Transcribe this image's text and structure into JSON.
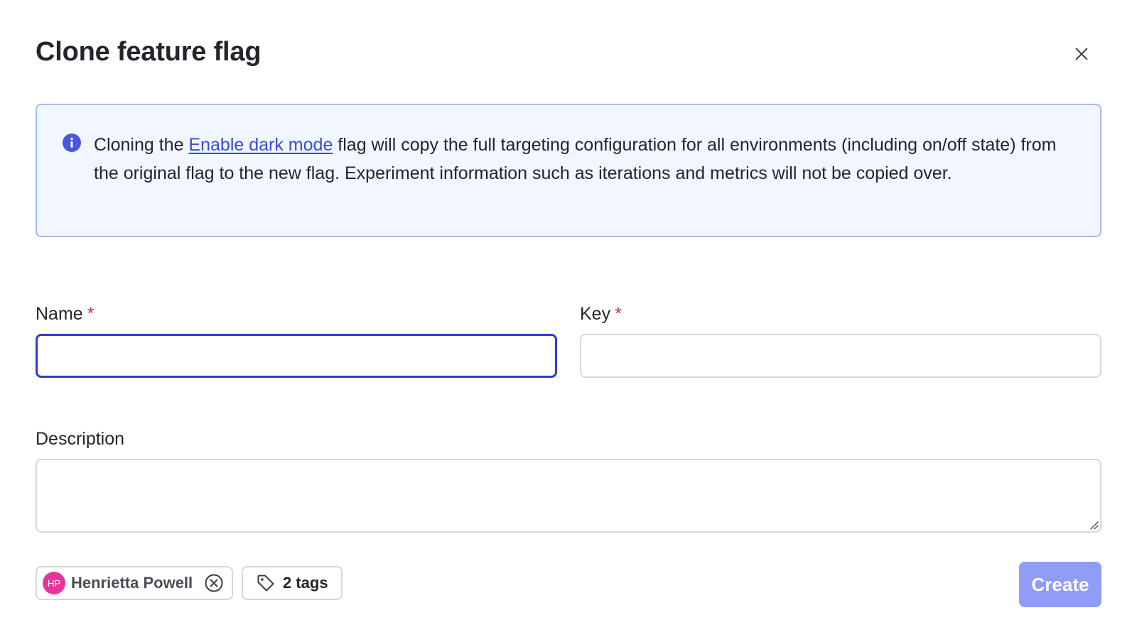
{
  "dialog": {
    "title": "Clone feature flag",
    "close_icon": "close-icon"
  },
  "info": {
    "icon": "info-icon",
    "text_before_link": "Cloning the ",
    "link_text": "Enable dark mode",
    "text_after_link": " flag will copy the full targeting configuration for all environments (including on/off state) from the original flag to the new flag. Experiment information such as iterations and metrics will not be copied over."
  },
  "form": {
    "name_label": "Name",
    "key_label": "Key",
    "description_label": "Description",
    "required_marker": "*",
    "name_value": "",
    "key_value": "",
    "description_value": ""
  },
  "maintainer": {
    "initials": "HP",
    "name": "Henrietta Powell",
    "avatar_color": "#e8349a"
  },
  "tags": {
    "label": "2 tags",
    "icon": "tag-icon"
  },
  "actions": {
    "create_label": "Create"
  },
  "colors": {
    "accent": "#2d3ccf",
    "primary_button_disabled": "#8f9cf8",
    "required": "#d0244f",
    "info_bg": "#f2f6fe",
    "info_border": "#a9b9f0"
  }
}
